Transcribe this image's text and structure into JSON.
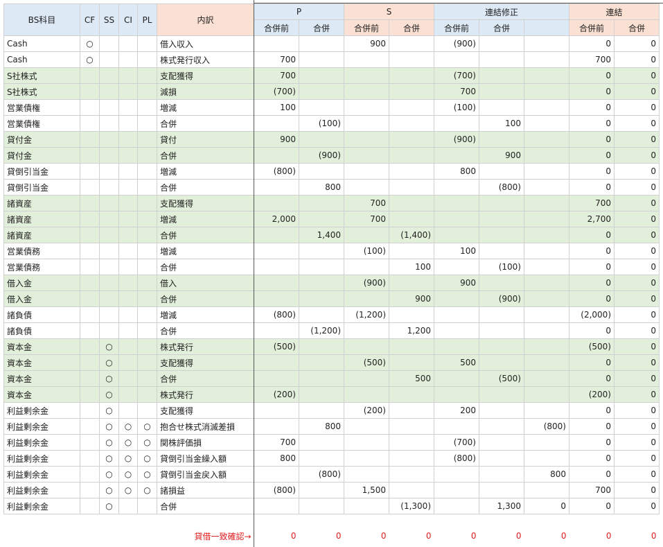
{
  "headers": {
    "bs": "BS科目",
    "cf": "CF",
    "ss": "SS",
    "ci": "CI",
    "pl": "PL",
    "detail": "内訳",
    "p": "P",
    "s": "S",
    "adj": "連結修正",
    "cons": "連結",
    "pre": "合併前",
    "post": "合併"
  },
  "rows": [
    {
      "bs": "Cash",
      "cf": "○",
      "ss": "",
      "ci": "",
      "pl": "",
      "d": "借入収入",
      "pp": "",
      "pm": "",
      "sp": "900",
      "sm": "",
      "ap": "(900)",
      "am": "",
      "ax": "",
      "cp": "0",
      "cm": "0",
      "g": false
    },
    {
      "bs": "Cash",
      "cf": "○",
      "ss": "",
      "ci": "",
      "pl": "",
      "d": "株式発行収入",
      "pp": "700",
      "pm": "",
      "sp": "",
      "sm": "",
      "ap": "",
      "am": "",
      "ax": "",
      "cp": "700",
      "cm": "0",
      "g": false
    },
    {
      "bs": "S社株式",
      "cf": "",
      "ss": "",
      "ci": "",
      "pl": "",
      "d": "支配獲得",
      "pp": "700",
      "pm": "",
      "sp": "",
      "sm": "",
      "ap": "(700)",
      "am": "",
      "ax": "",
      "cp": "0",
      "cm": "0",
      "g": true
    },
    {
      "bs": "S社株式",
      "cf": "",
      "ss": "",
      "ci": "",
      "pl": "",
      "d": "減損",
      "pp": "(700)",
      "pm": "",
      "sp": "",
      "sm": "",
      "ap": "700",
      "am": "",
      "ax": "",
      "cp": "0",
      "cm": "0",
      "g": true
    },
    {
      "bs": "営業債権",
      "cf": "",
      "ss": "",
      "ci": "",
      "pl": "",
      "d": "増減",
      "pp": "100",
      "pm": "",
      "sp": "",
      "sm": "",
      "ap": "(100)",
      "am": "",
      "ax": "",
      "cp": "0",
      "cm": "0",
      "g": false
    },
    {
      "bs": "営業債権",
      "cf": "",
      "ss": "",
      "ci": "",
      "pl": "",
      "d": "合併",
      "pp": "",
      "pm": "(100)",
      "sp": "",
      "sm": "",
      "ap": "",
      "am": "100",
      "ax": "",
      "cp": "0",
      "cm": "0",
      "g": false
    },
    {
      "bs": "貸付金",
      "cf": "",
      "ss": "",
      "ci": "",
      "pl": "",
      "d": "貸付",
      "pp": "900",
      "pm": "",
      "sp": "",
      "sm": "",
      "ap": "(900)",
      "am": "",
      "ax": "",
      "cp": "0",
      "cm": "0",
      "g": true
    },
    {
      "bs": "貸付金",
      "cf": "",
      "ss": "",
      "ci": "",
      "pl": "",
      "d": "合併",
      "pp": "",
      "pm": "(900)",
      "sp": "",
      "sm": "",
      "ap": "",
      "am": "900",
      "ax": "",
      "cp": "0",
      "cm": "0",
      "g": true
    },
    {
      "bs": "貸倒引当金",
      "cf": "",
      "ss": "",
      "ci": "",
      "pl": "",
      "d": "増減",
      "pp": "(800)",
      "pm": "",
      "sp": "",
      "sm": "",
      "ap": "800",
      "am": "",
      "ax": "",
      "cp": "0",
      "cm": "0",
      "g": false
    },
    {
      "bs": "貸倒引当金",
      "cf": "",
      "ss": "",
      "ci": "",
      "pl": "",
      "d": "合併",
      "pp": "",
      "pm": "800",
      "sp": "",
      "sm": "",
      "ap": "",
      "am": "(800)",
      "ax": "",
      "cp": "0",
      "cm": "0",
      "g": false
    },
    {
      "bs": "諸資産",
      "cf": "",
      "ss": "",
      "ci": "",
      "pl": "",
      "d": "支配獲得",
      "pp": "",
      "pm": "",
      "sp": "700",
      "sm": "",
      "ap": "",
      "am": "",
      "ax": "",
      "cp": "700",
      "cm": "0",
      "g": true
    },
    {
      "bs": "諸資産",
      "cf": "",
      "ss": "",
      "ci": "",
      "pl": "",
      "d": "増減",
      "pp": "2,000",
      "pm": "",
      "sp": "700",
      "sm": "",
      "ap": "",
      "am": "",
      "ax": "",
      "cp": "2,700",
      "cm": "0",
      "g": true
    },
    {
      "bs": "諸資産",
      "cf": "",
      "ss": "",
      "ci": "",
      "pl": "",
      "d": "合併",
      "pp": "",
      "pm": "1,400",
      "sp": "",
      "sm": "(1,400)",
      "ap": "",
      "am": "",
      "ax": "",
      "cp": "0",
      "cm": "0",
      "g": true
    },
    {
      "bs": "営業債務",
      "cf": "",
      "ss": "",
      "ci": "",
      "pl": "",
      "d": "増減",
      "pp": "",
      "pm": "",
      "sp": "(100)",
      "sm": "",
      "ap": "100",
      "am": "",
      "ax": "",
      "cp": "0",
      "cm": "0",
      "g": false
    },
    {
      "bs": "営業債務",
      "cf": "",
      "ss": "",
      "ci": "",
      "pl": "",
      "d": "合併",
      "pp": "",
      "pm": "",
      "sp": "",
      "sm": "100",
      "ap": "",
      "am": "(100)",
      "ax": "",
      "cp": "0",
      "cm": "0",
      "g": false
    },
    {
      "bs": "借入金",
      "cf": "",
      "ss": "",
      "ci": "",
      "pl": "",
      "d": "借入",
      "pp": "",
      "pm": "",
      "sp": "(900)",
      "sm": "",
      "ap": "900",
      "am": "",
      "ax": "",
      "cp": "0",
      "cm": "0",
      "g": true
    },
    {
      "bs": "借入金",
      "cf": "",
      "ss": "",
      "ci": "",
      "pl": "",
      "d": "合併",
      "pp": "",
      "pm": "",
      "sp": "",
      "sm": "900",
      "ap": "",
      "am": "(900)",
      "ax": "",
      "cp": "0",
      "cm": "0",
      "g": true
    },
    {
      "bs": "諸負債",
      "cf": "",
      "ss": "",
      "ci": "",
      "pl": "",
      "d": "増減",
      "pp": "(800)",
      "pm": "",
      "sp": "(1,200)",
      "sm": "",
      "ap": "",
      "am": "",
      "ax": "",
      "cp": "(2,000)",
      "cm": "0",
      "g": false
    },
    {
      "bs": "諸負債",
      "cf": "",
      "ss": "",
      "ci": "",
      "pl": "",
      "d": "合併",
      "pp": "",
      "pm": "(1,200)",
      "sp": "",
      "sm": "1,200",
      "ap": "",
      "am": "",
      "ax": "",
      "cp": "0",
      "cm": "0",
      "g": false
    },
    {
      "bs": "資本金",
      "cf": "",
      "ss": "○",
      "ci": "",
      "pl": "",
      "d": "株式発行",
      "pp": "(500)",
      "pm": "",
      "sp": "",
      "sm": "",
      "ap": "",
      "am": "",
      "ax": "",
      "cp": "(500)",
      "cm": "0",
      "g": true
    },
    {
      "bs": "資本金",
      "cf": "",
      "ss": "○",
      "ci": "",
      "pl": "",
      "d": "支配獲得",
      "pp": "",
      "pm": "",
      "sp": "(500)",
      "sm": "",
      "ap": "500",
      "am": "",
      "ax": "",
      "cp": "0",
      "cm": "0",
      "g": true
    },
    {
      "bs": "資本金",
      "cf": "",
      "ss": "○",
      "ci": "",
      "pl": "",
      "d": "合併",
      "pp": "",
      "pm": "",
      "sp": "",
      "sm": "500",
      "ap": "",
      "am": "(500)",
      "ax": "",
      "cp": "0",
      "cm": "0",
      "g": true
    },
    {
      "bs": "資本金",
      "cf": "",
      "ss": "○",
      "ci": "",
      "pl": "",
      "d": "株式発行",
      "pp": "(200)",
      "pm": "",
      "sp": "",
      "sm": "",
      "ap": "",
      "am": "",
      "ax": "",
      "cp": "(200)",
      "cm": "0",
      "g": true
    },
    {
      "bs": "利益剰余金",
      "cf": "",
      "ss": "○",
      "ci": "",
      "pl": "",
      "d": "支配獲得",
      "pp": "",
      "pm": "",
      "sp": "(200)",
      "sm": "",
      "ap": "200",
      "am": "",
      "ax": "",
      "cp": "0",
      "cm": "0",
      "g": false
    },
    {
      "bs": "利益剰余金",
      "cf": "",
      "ss": "○",
      "ci": "○",
      "pl": "○",
      "d": "抱合せ株式消滅差損",
      "pp": "",
      "pm": "800",
      "sp": "",
      "sm": "",
      "ap": "",
      "am": "",
      "ax": "(800)",
      "cp": "0",
      "cm": "0",
      "g": false
    },
    {
      "bs": "利益剰余金",
      "cf": "",
      "ss": "○",
      "ci": "○",
      "pl": "○",
      "d": "関株評価損",
      "pp": "700",
      "pm": "",
      "sp": "",
      "sm": "",
      "ap": "(700)",
      "am": "",
      "ax": "",
      "cp": "0",
      "cm": "0",
      "g": false
    },
    {
      "bs": "利益剰余金",
      "cf": "",
      "ss": "○",
      "ci": "○",
      "pl": "○",
      "d": "貸倒引当金繰入額",
      "pp": "800",
      "pm": "",
      "sp": "",
      "sm": "",
      "ap": "(800)",
      "am": "",
      "ax": "",
      "cp": "0",
      "cm": "0",
      "g": false
    },
    {
      "bs": "利益剰余金",
      "cf": "",
      "ss": "○",
      "ci": "○",
      "pl": "○",
      "d": "貸倒引当金戻入額",
      "pp": "",
      "pm": "(800)",
      "sp": "",
      "sm": "",
      "ap": "",
      "am": "",
      "ax": "800",
      "cp": "0",
      "cm": "0",
      "g": false
    },
    {
      "bs": "利益剰余金",
      "cf": "",
      "ss": "○",
      "ci": "○",
      "pl": "○",
      "d": "諸損益",
      "pp": "(800)",
      "pm": "",
      "sp": "1,500",
      "sm": "",
      "ap": "",
      "am": "",
      "ax": "",
      "cp": "700",
      "cm": "0",
      "g": false
    },
    {
      "bs": "利益剰余金",
      "cf": "",
      "ss": "○",
      "ci": "",
      "pl": "",
      "d": "合併",
      "pp": "",
      "pm": "",
      "sp": "",
      "sm": "(1,300)",
      "ap": "",
      "am": "1,300",
      "ax": "0",
      "cp": "0",
      "cm": "0",
      "g": false
    }
  ],
  "check": {
    "label": "貸借一致確認→",
    "values": [
      "0",
      "0",
      "0",
      "0",
      "0",
      "0",
      "0",
      "0",
      "0"
    ]
  }
}
